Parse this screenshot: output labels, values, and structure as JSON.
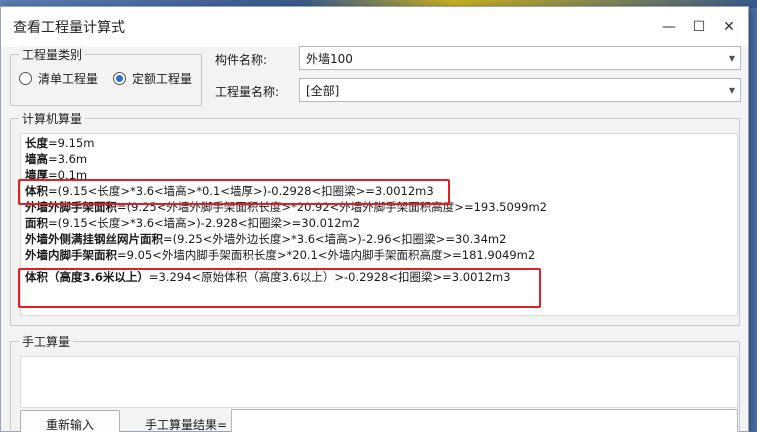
{
  "window": {
    "title": "查看工程量计算式",
    "minimize_glyph": "—",
    "maximize_glyph": "☐",
    "close_glyph": "✕"
  },
  "quantity_type": {
    "legend": "工程量类别",
    "options": [
      {
        "label": "清单工程量",
        "checked": false
      },
      {
        "label": "定额工程量",
        "checked": true
      }
    ]
  },
  "component_name": {
    "label": "构件名称:",
    "value": "外墙100"
  },
  "quantity_name": {
    "label": "工程量名称:",
    "value": "[全部]"
  },
  "computer_calc": {
    "legend": "计算机算量",
    "lines": [
      {
        "label": "长度",
        "expr": "=9.15m"
      },
      {
        "label": "墙高",
        "expr": "=3.6m"
      },
      {
        "label": "墙厚",
        "expr": "=0.1m"
      },
      {
        "label": "体积",
        "expr": "=(9.15<长度>*3.6<墙高>*0.1<墙厚>)-0.2928<扣圈梁>=3.0012m3"
      },
      {
        "label": "外墙外脚手架面积",
        "expr": "=(9.25<外墙外脚手架面积长度>*20.92<外墙外脚手架面积高度>=193.5099m2"
      },
      {
        "label": "面积",
        "expr": "=(9.15<长度>*3.6<墙高>)-2.928<扣圈梁>=30.012m2"
      },
      {
        "label": "外墙外侧满挂钢丝网片面积",
        "expr": "=(9.25<外墙外边长度>*3.6<墙高>)-2.96<扣圈梁>=30.34m2"
      },
      {
        "label": "外墙内脚手架面积",
        "expr": "=9.05<外墙内脚手架面积长度>*20.1<外墙内脚手架面积高度>=181.9049m2"
      },
      {
        "label": "体积（高度3.6米以上）",
        "expr": "=3.294<原始体积（高度3.6以上）>-0.2928<扣圈梁>=3.0012m3"
      }
    ]
  },
  "manual_calc": {
    "legend": "手工算量",
    "reenter_button": "重新输入",
    "result_label": "手工算量结果="
  },
  "colors": {
    "highlight_border": "#e02020",
    "radio_accent": "#2d6fd1"
  }
}
